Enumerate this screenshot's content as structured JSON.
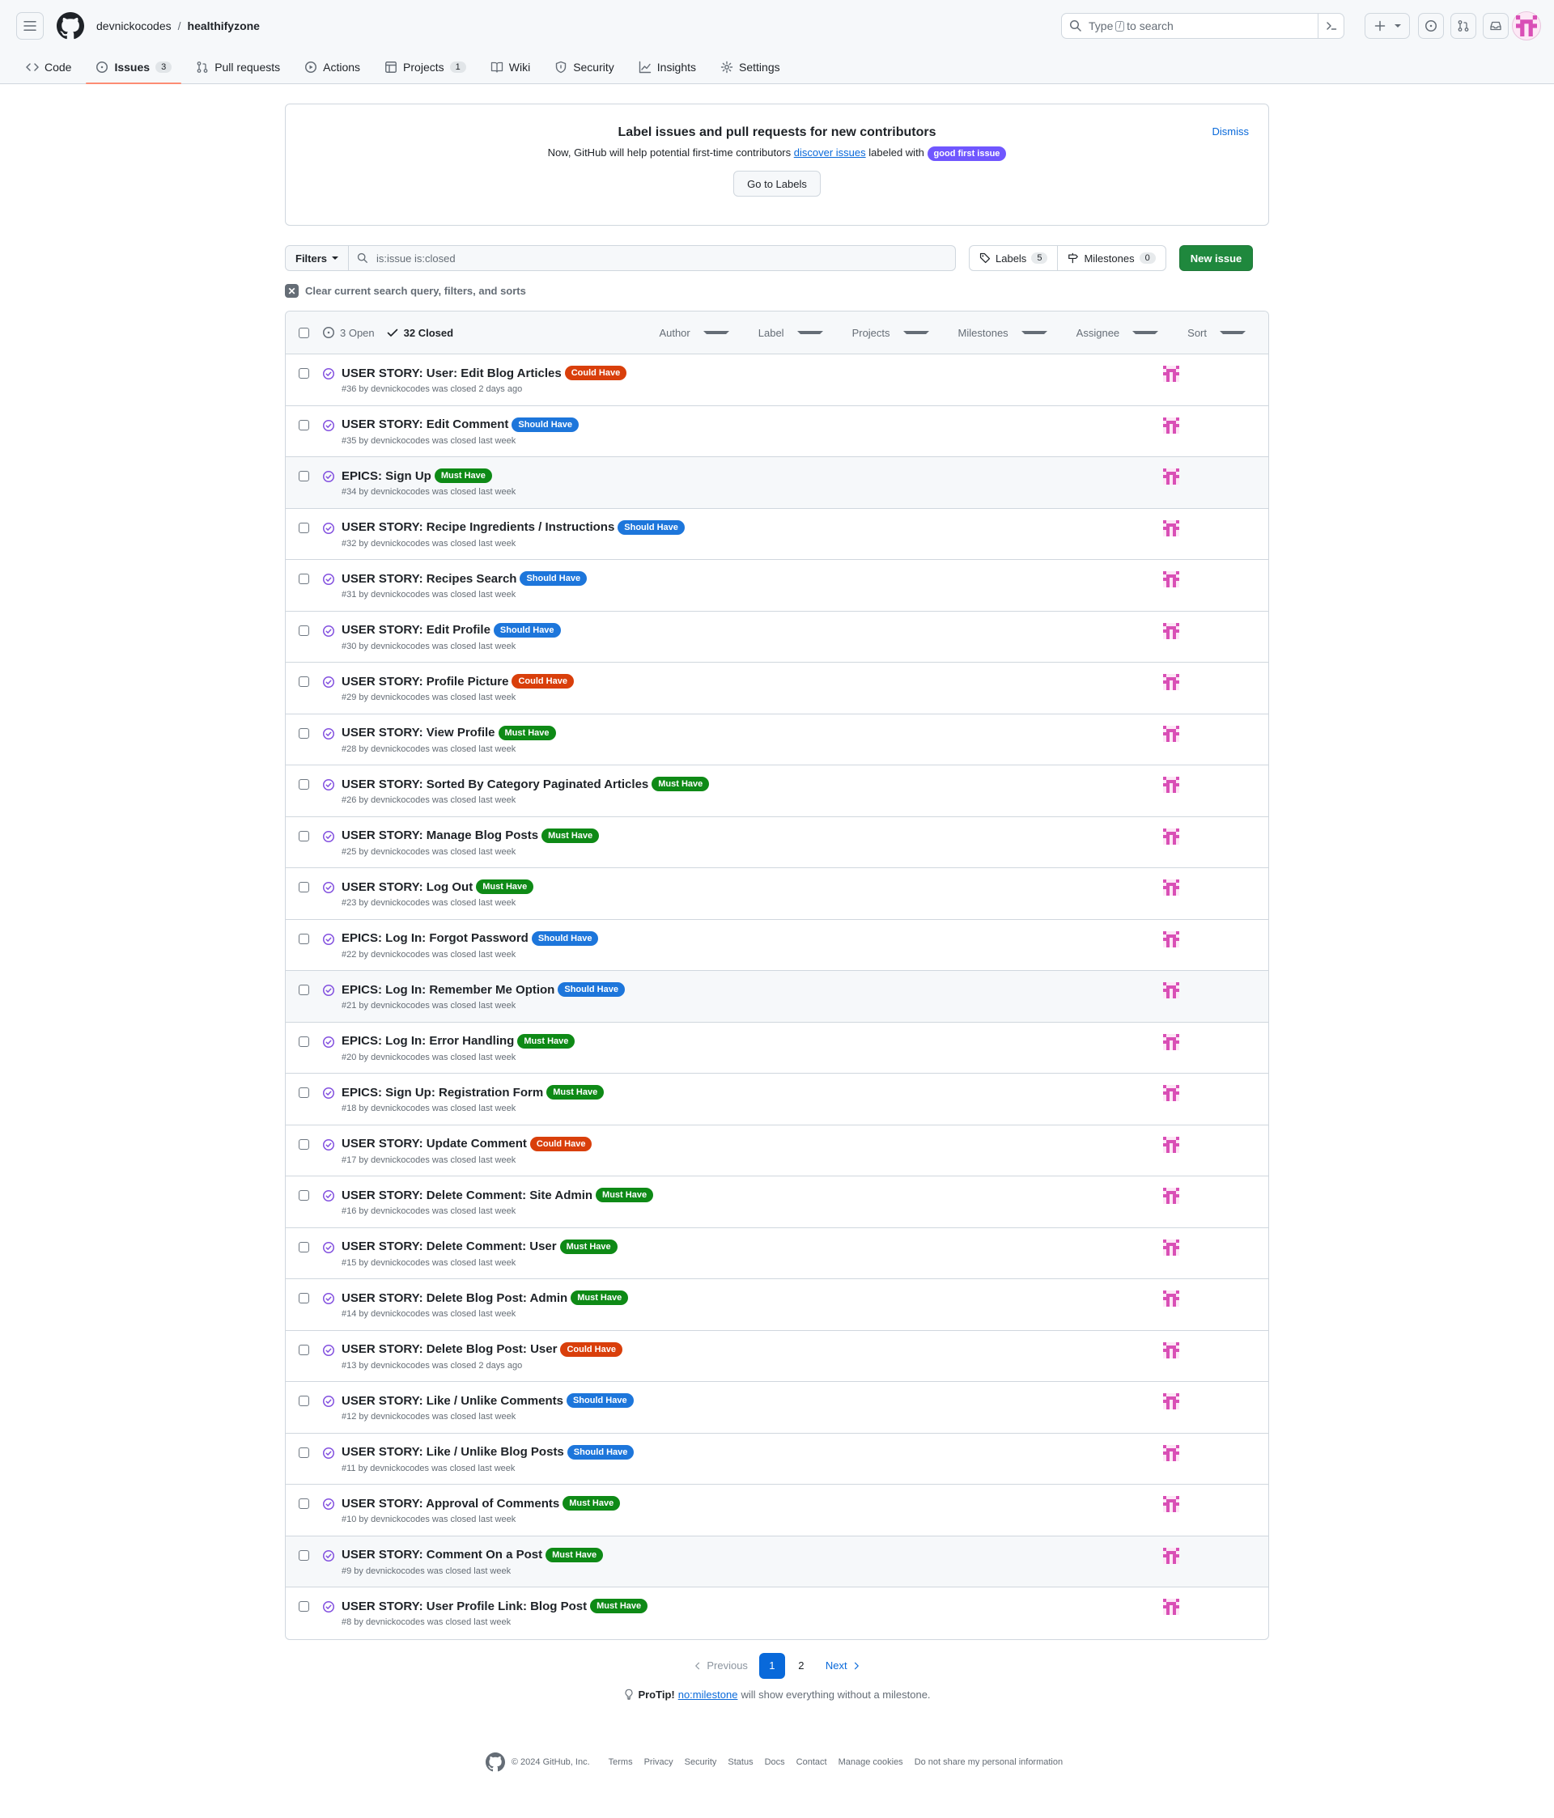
{
  "header": {
    "owner": "devnickocodes",
    "separator": "/",
    "repo": "healthifyzone",
    "search": {
      "prefix": "Type",
      "slash": "/",
      "suffix": "to search"
    }
  },
  "tabs": [
    {
      "label": "Code",
      "icon": "code-icon"
    },
    {
      "label": "Issues",
      "icon": "issue-opened-icon",
      "count": "3",
      "active": true
    },
    {
      "label": "Pull requests",
      "icon": "git-pull-request-icon"
    },
    {
      "label": "Actions",
      "icon": "play-icon"
    },
    {
      "label": "Projects",
      "icon": "table-icon",
      "count": "1"
    },
    {
      "label": "Wiki",
      "icon": "book-icon"
    },
    {
      "label": "Security",
      "icon": "shield-icon"
    },
    {
      "label": "Insights",
      "icon": "graph-icon"
    },
    {
      "label": "Settings",
      "icon": "gear-icon"
    }
  ],
  "banner": {
    "title": "Label issues and pull requests for new contributors",
    "text_before": "Now, GitHub will help potential first-time contributors",
    "link": "discover issues",
    "text_after": "labeled with",
    "label": "good first issue",
    "button": "Go to Labels",
    "dismiss": "Dismiss"
  },
  "toolbar": {
    "filters": "Filters",
    "query": "is:issue is:closed",
    "labels": "Labels",
    "labels_count": "5",
    "milestones": "Milestones",
    "milestones_count": "0",
    "new_issue": "New issue",
    "clear": "Clear current search query, filters, and sorts"
  },
  "list_header": {
    "open": "3 Open",
    "closed": "32 Closed",
    "filters": [
      "Author",
      "Label",
      "Projects",
      "Milestones",
      "Assignee",
      "Sort"
    ]
  },
  "label_colors": {
    "Must Have": "#0e8a16",
    "Should Have": "#1d76db",
    "Could Have": "#d93f0b",
    "good first issue": "#7057ff"
  },
  "issues": [
    {
      "title": "USER STORY: User: Edit Blog Articles",
      "label": "Could Have",
      "meta": "#36 by devnickocodes was closed 2 days ago"
    },
    {
      "title": "USER STORY: Edit Comment",
      "label": "Should Have",
      "meta": "#35 by devnickocodes was closed last week"
    },
    {
      "title": "EPICS: Sign Up",
      "label": "Must Have",
      "meta": "#34 by devnickocodes was closed last week",
      "hl": true
    },
    {
      "title": "USER STORY: Recipe Ingredients / Instructions",
      "label": "Should Have",
      "meta": "#32 by devnickocodes was closed last week"
    },
    {
      "title": "USER STORY: Recipes Search",
      "label": "Should Have",
      "meta": "#31 by devnickocodes was closed last week"
    },
    {
      "title": "USER STORY: Edit Profile",
      "label": "Should Have",
      "meta": "#30 by devnickocodes was closed last week"
    },
    {
      "title": "USER STORY: Profile Picture",
      "label": "Could Have",
      "meta": "#29 by devnickocodes was closed last week"
    },
    {
      "title": "USER STORY: View Profile",
      "label": "Must Have",
      "meta": "#28 by devnickocodes was closed last week"
    },
    {
      "title": "USER STORY: Sorted By Category Paginated Articles",
      "label": "Must Have",
      "meta": "#26 by devnickocodes was closed last week"
    },
    {
      "title": "USER STORY: Manage Blog Posts",
      "label": "Must Have",
      "meta": "#25 by devnickocodes was closed last week"
    },
    {
      "title": "USER STORY: Log Out",
      "label": "Must Have",
      "meta": "#23 by devnickocodes was closed last week"
    },
    {
      "title": "EPICS: Log In: Forgot Password",
      "label": "Should Have",
      "meta": "#22 by devnickocodes was closed last week"
    },
    {
      "title": "EPICS: Log In: Remember Me Option",
      "label": "Should Have",
      "meta": "#21 by devnickocodes was closed last week",
      "hl": true
    },
    {
      "title": "EPICS: Log In: Error Handling",
      "label": "Must Have",
      "meta": "#20 by devnickocodes was closed last week"
    },
    {
      "title": "EPICS: Sign Up: Registration Form",
      "label": "Must Have",
      "meta": "#18 by devnickocodes was closed last week"
    },
    {
      "title": "USER STORY: Update Comment",
      "label": "Could Have",
      "meta": "#17 by devnickocodes was closed last week"
    },
    {
      "title": "USER STORY: Delete Comment: Site Admin",
      "label": "Must Have",
      "meta": "#16 by devnickocodes was closed last week"
    },
    {
      "title": "USER STORY: Delete Comment: User",
      "label": "Must Have",
      "meta": "#15 by devnickocodes was closed last week"
    },
    {
      "title": "USER STORY: Delete Blog Post: Admin",
      "label": "Must Have",
      "meta": "#14 by devnickocodes was closed last week"
    },
    {
      "title": "USER STORY: Delete Blog Post: User",
      "label": "Could Have",
      "meta": "#13 by devnickocodes was closed 2 days ago"
    },
    {
      "title": "USER STORY: Like / Unlike Comments",
      "label": "Should Have",
      "meta": "#12 by devnickocodes was closed last week"
    },
    {
      "title": "USER STORY: Like / Unlike Blog Posts",
      "label": "Should Have",
      "meta": "#11 by devnickocodes was closed last week"
    },
    {
      "title": "USER STORY: Approval of Comments",
      "label": "Must Have",
      "meta": "#10 by devnickocodes was closed last week"
    },
    {
      "title": "USER STORY: Comment On a Post",
      "label": "Must Have",
      "meta": "#9 by devnickocodes was closed last week",
      "hl": true
    },
    {
      "title": "USER STORY: User Profile Link: Blog Post",
      "label": "Must Have",
      "meta": "#8 by devnickocodes was closed last week"
    }
  ],
  "pagination": {
    "previous": "Previous",
    "pages": [
      "1",
      "2"
    ],
    "current": "1",
    "next": "Next"
  },
  "protip": {
    "bold": "ProTip!",
    "link": "no:milestone",
    "text": "will show everything without a milestone."
  },
  "footer": {
    "copyright": "© 2024 GitHub, Inc.",
    "links": [
      "Terms",
      "Privacy",
      "Security",
      "Status",
      "Docs",
      "Contact",
      "Manage cookies",
      "Do not share my personal information"
    ]
  }
}
